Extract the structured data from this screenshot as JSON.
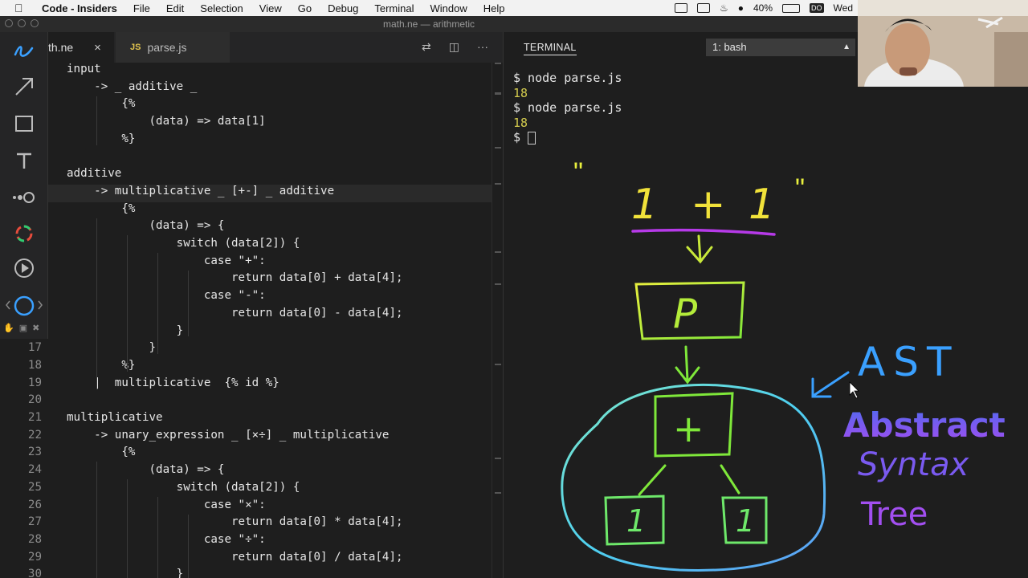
{
  "menubar": {
    "app": "Code - Insiders",
    "items": [
      "File",
      "Edit",
      "Selection",
      "View",
      "Go",
      "Debug",
      "Terminal",
      "Window",
      "Help"
    ],
    "battery": "40%",
    "day": "Wed",
    "badge": "DO"
  },
  "window": {
    "title": "math.ne — arithmetic"
  },
  "tabs": [
    {
      "label": "th.ne",
      "close": "×"
    },
    {
      "badge": "JS",
      "label": "parse.js"
    }
  ],
  "code": {
    "lines": [
      {
        "n": "",
        "t": "input"
      },
      {
        "n": "",
        "t": "    -> _ additive _"
      },
      {
        "n": "",
        "t": "        {%"
      },
      {
        "n": "",
        "t": "            (data) => data[1]"
      },
      {
        "n": "",
        "t": "        %}"
      },
      {
        "n": "",
        "t": ""
      },
      {
        "n": "",
        "t": "additive"
      },
      {
        "n": "",
        "t": "    -> multiplicative _ [+-] _ additive"
      },
      {
        "n": "",
        "t": "        {%"
      },
      {
        "n": "",
        "t": "            (data) => {"
      },
      {
        "n": "",
        "t": "                switch (data[2]) {"
      },
      {
        "n": "",
        "t": "                    case \"+\":"
      },
      {
        "n": "",
        "t": "                        return data[0] + data[4];"
      },
      {
        "n": "",
        "t": "                    case \"-\":"
      },
      {
        "n": "",
        "t": "                        return data[0] - data[4];"
      },
      {
        "n": "",
        "t": "                }"
      },
      {
        "n": "17",
        "t": "            }"
      },
      {
        "n": "18",
        "t": "        %}"
      },
      {
        "n": "19",
        "t": "    |  multiplicative  {% id %}"
      },
      {
        "n": "20",
        "t": ""
      },
      {
        "n": "21",
        "t": "multiplicative"
      },
      {
        "n": "22",
        "t": "    -> unary_expression _ [×÷] _ multiplicative"
      },
      {
        "n": "23",
        "t": "        {%"
      },
      {
        "n": "24",
        "t": "            (data) => {"
      },
      {
        "n": "25",
        "t": "                switch (data[2]) {"
      },
      {
        "n": "26",
        "t": "                    case \"×\":"
      },
      {
        "n": "27",
        "t": "                        return data[0] * data[4];"
      },
      {
        "n": "28",
        "t": "                    case \"÷\":"
      },
      {
        "n": "29",
        "t": "                        return data[0] / data[4];"
      },
      {
        "n": "30",
        "t": "                }"
      }
    ]
  },
  "terminal": {
    "title": "TERMINAL",
    "selector": "1: bash",
    "lines": [
      {
        "t": "$ node parse.js",
        "kind": "cmd"
      },
      {
        "t": "18",
        "kind": "out"
      },
      {
        "t": "$ node parse.js",
        "kind": "cmd"
      },
      {
        "t": "18",
        "kind": "out"
      },
      {
        "t": "$ ",
        "kind": "prompt"
      }
    ]
  },
  "drawing": {
    "expression": {
      "open_quote": "\"",
      "lhs": "1",
      "op": "+",
      "rhs": "1",
      "close_quote": "\""
    },
    "parser_box": "P",
    "root_node": "+",
    "left_leaf": "1",
    "right_leaf": "1",
    "ast_label": "AST",
    "expansion": [
      "Abstract",
      "Syntax",
      "Tree"
    ]
  }
}
